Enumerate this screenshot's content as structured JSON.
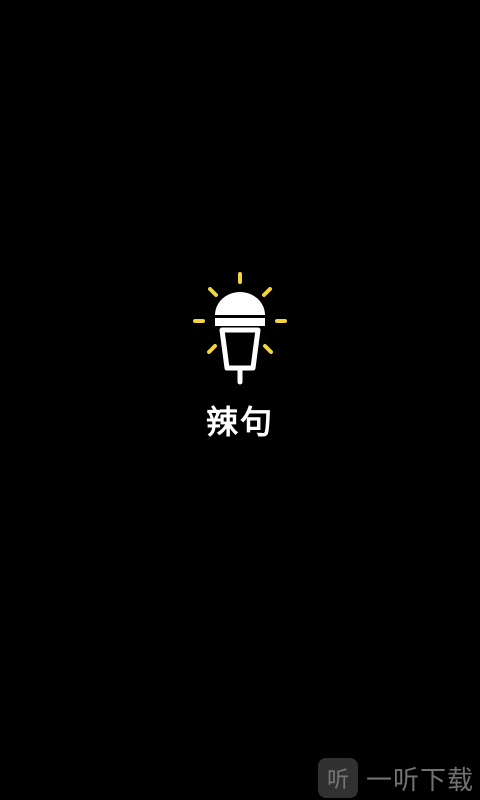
{
  "app": {
    "name": "辣句",
    "logo_icon": "microphone-lightbulb-icon"
  },
  "watermark": {
    "badge": "听",
    "text": "一听下载"
  },
  "colors": {
    "background": "#000000",
    "rays": "#F2D43C",
    "logo": "#FFFFFF"
  }
}
